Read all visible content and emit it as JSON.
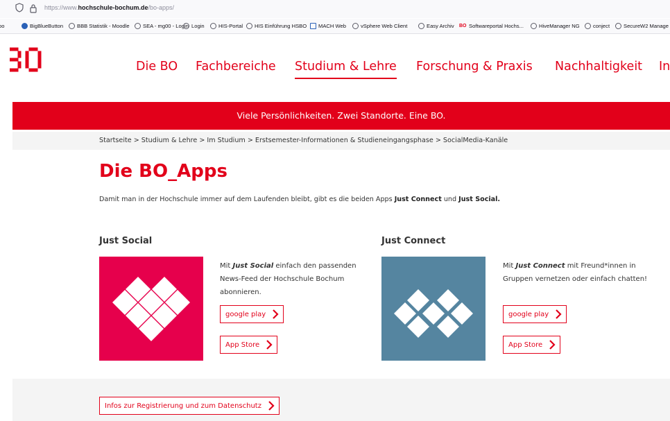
{
  "browser": {
    "url_prefix": "https://www.",
    "url_domain": "hochschule-bochum.de",
    "url_path": "/bo-apps/",
    "bookmarks": [
      {
        "label": "bo",
        "icon": "none"
      },
      {
        "label": "BigBlueButton",
        "icon": "bbb-icon"
      },
      {
        "label": "BBB Statistik - Moodle",
        "icon": "globe-icon"
      },
      {
        "label": "SEA - mg00 - Login",
        "icon": "globe-icon"
      },
      {
        "label": "Login",
        "icon": "globe-icon"
      },
      {
        "label": "HIS-Portal",
        "icon": "globe-icon"
      },
      {
        "label": "HIS Einführung HSBO",
        "icon": "globe-icon"
      },
      {
        "label": "MACH Web",
        "icon": "mach-icon"
      },
      {
        "label": "vSphere Web Client",
        "icon": "globe-icon"
      },
      {
        "label": "Easy Archiv",
        "icon": "globe-icon"
      },
      {
        "label": "Softwareportal Hochs...",
        "icon": "bo-icon"
      },
      {
        "label": "HiveManager NG",
        "icon": "globe-icon"
      },
      {
        "label": "conject",
        "icon": "globe-icon"
      },
      {
        "label": "SecureW2 Manage",
        "icon": "globe-icon"
      }
    ]
  },
  "nav": {
    "items": [
      "Die BO",
      "Fachbereiche",
      "Studium & Lehre",
      "Forschung & Praxis",
      "Nachhaltigkeit",
      "In"
    ],
    "active": "Studium & Lehre"
  },
  "banner": "Viele Persönlichkeiten. Zwei Standorte. Eine BO.",
  "breadcrumb": "Startseite > Studium & Lehre > Im Studium > Erstsemester-Informationen & Studieneingangsphase > SocialMedia-Kanäle",
  "title": "Die BO_Apps",
  "intro": {
    "text": "Damit man in der Hochschule immer auf dem Laufenden bleibt, gibt es die beiden Apps ",
    "app1": "Just Connect",
    "and": " und ",
    "app2": "Just Social."
  },
  "apps": [
    {
      "heading": "Just Social",
      "desc_pre": "Mit ",
      "desc_app": "Just Social",
      "desc_post": " einfach den passenden News-Feed der Hochschule Bochum abonnieren.",
      "google_play": "google play",
      "app_store": "App Store",
      "color": "#e6004c"
    },
    {
      "heading": "Just Connect",
      "desc_pre": "Mit ",
      "desc_app": "Just Connect",
      "desc_post": " mit Freund*innen in Gruppen vernetzen oder einfach chatten!",
      "google_play": "google play",
      "app_store": "App Store",
      "color": "#5585a0"
    }
  ],
  "info_button": "Infos zur Registrierung und zum Datenschutz",
  "colors": {
    "brand_red": "#e2001a",
    "social_pink": "#e6004c",
    "connect_blue": "#5585a0"
  }
}
